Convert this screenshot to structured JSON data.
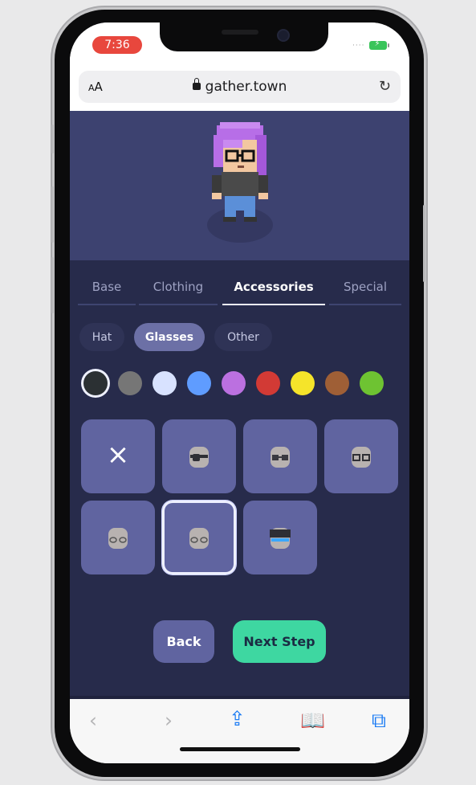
{
  "status": {
    "time": "7:36"
  },
  "browser": {
    "aa_label_small": "A",
    "aa_label_big": "A",
    "url": "gather.town"
  },
  "tabs": [
    {
      "label": "Base"
    },
    {
      "label": "Clothing"
    },
    {
      "label": "Accessories",
      "active": true
    },
    {
      "label": "Special"
    }
  ],
  "subtabs": [
    {
      "label": "Hat"
    },
    {
      "label": "Glasses",
      "active": true
    },
    {
      "label": "Other"
    }
  ],
  "colors": [
    "#2b3033",
    "#767676",
    "#d8e2ff",
    "#5f9cff",
    "#bb70e0",
    "#d23a35",
    "#f5e42a",
    "#9f5f36",
    "#6ec332"
  ],
  "selected_color_index": 0,
  "options": [
    {
      "type": "none",
      "symbol": "×"
    },
    {
      "type": "glasses",
      "variant": "eyepatch"
    },
    {
      "type": "glasses",
      "variant": "dark"
    },
    {
      "type": "glasses",
      "variant": "round"
    },
    {
      "type": "glasses",
      "variant": "thin"
    },
    {
      "type": "glasses",
      "variant": "round-thin",
      "selected": true
    },
    {
      "type": "glasses",
      "variant": "blue-visor"
    }
  ],
  "buttons": {
    "back": "Back",
    "next": "Next Step"
  },
  "toolbar_icons": [
    "back-arrow-icon",
    "forward-arrow-icon",
    "share-icon",
    "bookmarks-icon",
    "tabs-icon"
  ]
}
